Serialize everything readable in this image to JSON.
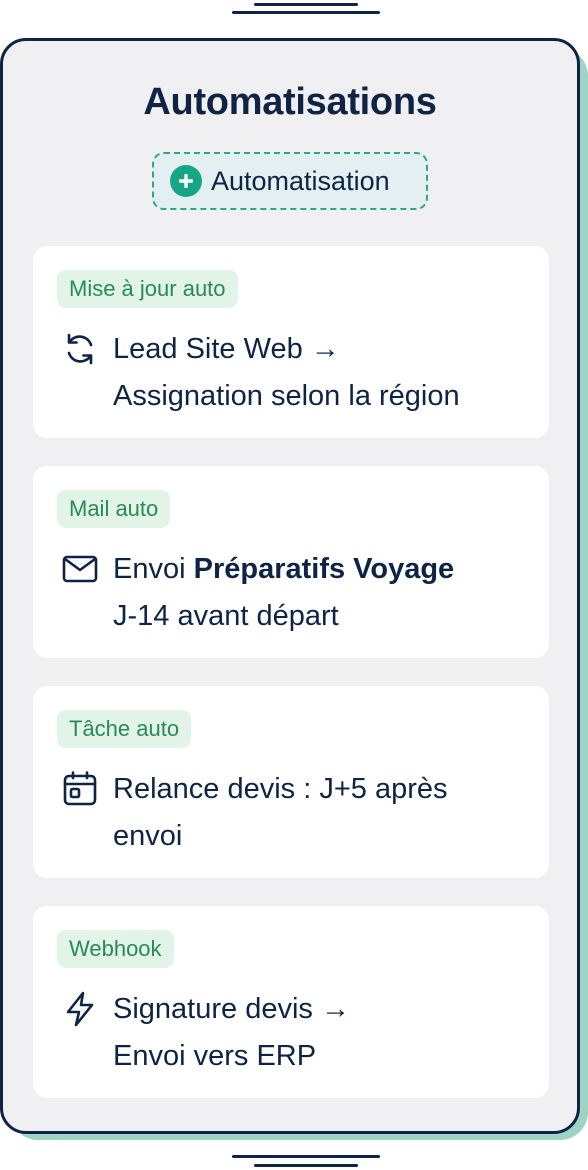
{
  "page": {
    "title": "Automatisations",
    "add_button_label": "Automatisation"
  },
  "cards": [
    {
      "badge": "Mise à jour auto",
      "icon": "refresh-icon",
      "line1": "Lead Site Web →",
      "line2": "Assignation selon la région"
    },
    {
      "badge": "Mail auto",
      "icon": "mail-icon",
      "prefix": "Envoi",
      "bold": "Préparatifs Voyage",
      "line2": "J-14 avant départ"
    },
    {
      "badge": "Tâche auto",
      "icon": "calendar-icon",
      "line1": "Relance devis : J+5 après",
      "line2": "envoi"
    },
    {
      "badge": "Webhook",
      "icon": "lightning-icon",
      "line1": "Signature devis →",
      "line2": "Envoi vers ERP"
    }
  ],
  "colors": {
    "navy": "#0f2444",
    "accent": "#17a587",
    "badge_bg": "#e2f4e8",
    "badge_text": "#2a8a55",
    "frame_bg": "#f0f0f2"
  }
}
